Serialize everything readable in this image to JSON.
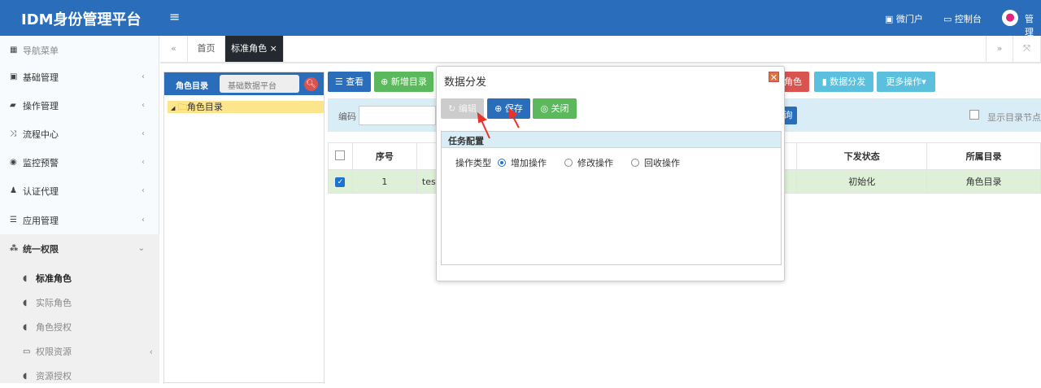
{
  "header": {
    "title": "IDM身份管理平台",
    "links": [
      "微门户",
      "控制台"
    ],
    "user": "管理"
  },
  "sidebar": {
    "title": "导航菜单",
    "items": [
      "基础管理",
      "操作管理",
      "流程中心",
      "监控预警",
      "认证代理",
      "应用管理",
      "统一权限"
    ],
    "sub_items": [
      "标准角色",
      "实际角色",
      "角色授权",
      "权限资源",
      "资源授权"
    ]
  },
  "tabs": {
    "items": [
      "首页",
      "标准角色"
    ],
    "active": "标准角色"
  },
  "left_panel": {
    "title": "角色目录",
    "search_value": "基础数据平台",
    "tree_root": "角色目录"
  },
  "toolbar": {
    "view": "查看",
    "add_dir": "新增目录",
    "delete_role_partial": "角色",
    "distribute": "数据分发",
    "more": "更多操作"
  },
  "search": {
    "code_label": "编码",
    "query_partial": "询",
    "show_dir_nodes": "显示目录节点"
  },
  "table": {
    "headers": [
      "序号",
      "",
      "下发状态",
      "所属目录"
    ],
    "rows": [
      {
        "checked": true,
        "index": "1",
        "name_partial": "test",
        "status": "初始化",
        "dir": "角色目录"
      }
    ]
  },
  "dialog": {
    "title": "数据分发",
    "edit": "编辑",
    "save": "保存",
    "close": "关闭",
    "section": "任务配置",
    "op_label": "操作类型",
    "options": [
      "增加操作",
      "修改操作",
      "回收操作"
    ],
    "selected": "增加操作"
  },
  "colors": {
    "header": "#2a6ebb",
    "green": "#5cb85c",
    "info": "#5bc0de",
    "danger": "#d9534f"
  }
}
